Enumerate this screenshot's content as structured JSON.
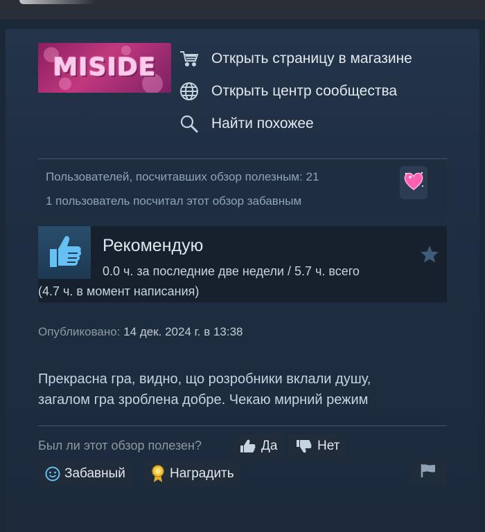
{
  "game": {
    "logo_text": "MISIDE"
  },
  "links": [
    {
      "icon": "cart-icon",
      "label": "Открыть страницу в магазине"
    },
    {
      "icon": "globe-icon",
      "label": "Открыть центр сообщества"
    },
    {
      "icon": "search-icon",
      "label": "Найти похожее"
    }
  ],
  "stats": {
    "helpful": "Пользователей, посчитавших обзор полезным: 21",
    "funny": "1 пользователь посчитал этот обзор забавным",
    "award_icon": "heart-award-icon"
  },
  "review": {
    "recommendation": "Рекомендую",
    "hours_line": "0.0 ч. за последние две недели / 5.7 ч. всего",
    "hours_at_review": "(4.7 ч. в момент написания)",
    "posted_label": "Опубликовано:",
    "posted_date": "14 дек. 2024 г. в 13:38",
    "text_line1": "Прекрасна гра, видно, що розробники вклали душу,",
    "text_line2": "загалом гра зроблена добре. Чекаю мирний режим"
  },
  "feedback": {
    "question": "Был ли этот обзор полезен?",
    "yes": "Да",
    "no": "Нет",
    "funny": "Забавный",
    "award": "Наградить"
  },
  "colors": {
    "accent_pink": "#ff5fb0",
    "thumb_blue": "#66c0f4"
  }
}
